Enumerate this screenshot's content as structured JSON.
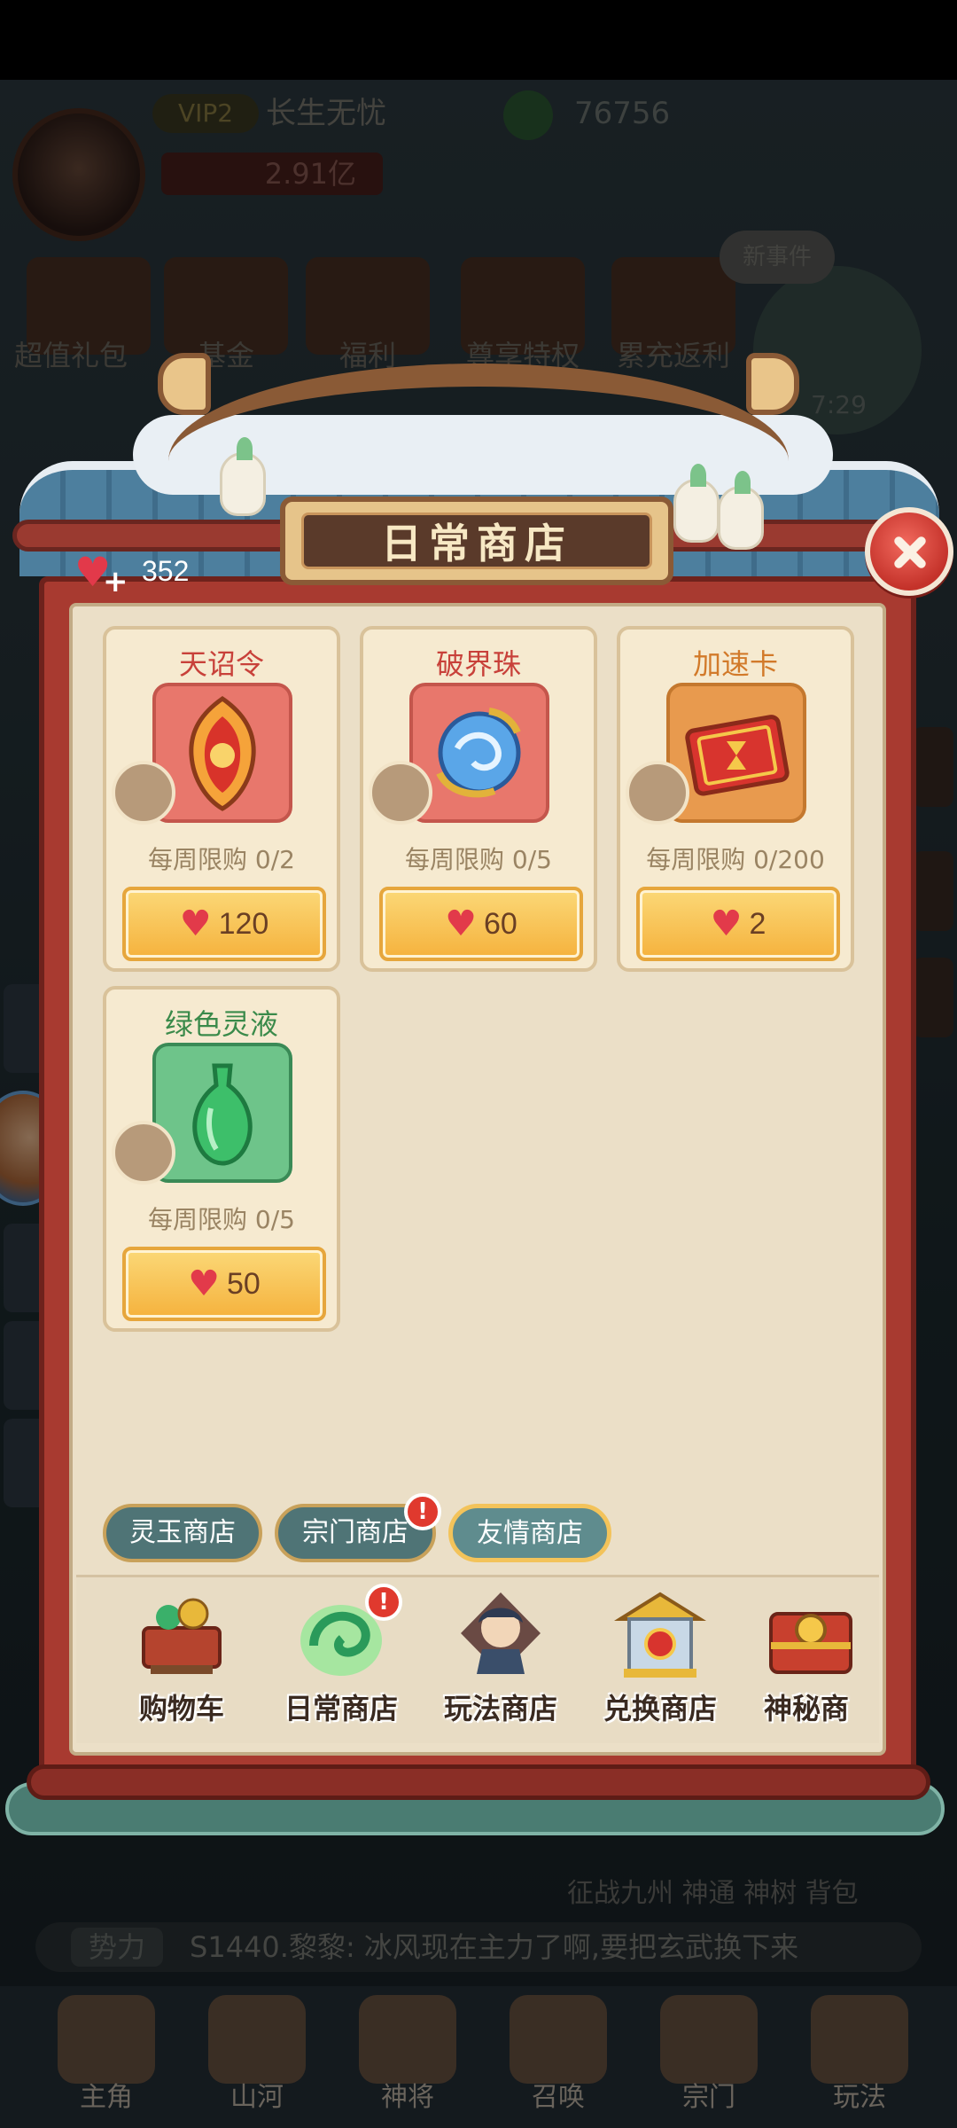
{
  "background": {
    "vip": "VIP2",
    "player_name": "长生无忧",
    "jade_amount": "76756",
    "power": "2.91亿",
    "top_icons": [
      "超值礼包",
      "基金",
      "福利",
      "尊享特权",
      "累充返利"
    ],
    "new_event": "新事件",
    "event_timer": "7:29",
    "bottom_icons": "征战九州   神通   神树   背包",
    "chat_tag": "势力",
    "chat_message": "S1440.黎黎:  冰风现在主力了啊,要把玄武换下来",
    "nav": [
      "主角",
      "山河",
      "神将",
      "召唤",
      "宗门",
      "玩法"
    ]
  },
  "modal": {
    "title": "日常商店",
    "currency_amount": "352",
    "items": [
      {
        "name": "天诏令",
        "limit": "每周限购 0/2",
        "price": "120",
        "name_color": "#c8413a",
        "icon": "scroll-token-icon"
      },
      {
        "name": "破界珠",
        "limit": "每周限购 0/5",
        "price": "60",
        "name_color": "#c8413a",
        "icon": "blue-orb-icon"
      },
      {
        "name": "加速卡",
        "limit": "每周限购 0/200",
        "price": "2",
        "name_color": "#d27a2a",
        "icon": "speed-card-icon"
      },
      {
        "name": "绿色灵液",
        "limit": "每周限购 0/5",
        "price": "50",
        "name_color": "#3a8a4a",
        "icon": "green-vase-icon"
      }
    ],
    "sub_tabs": [
      {
        "label": "灵玉商店",
        "badge": ""
      },
      {
        "label": "宗门商店",
        "badge": "!"
      },
      {
        "label": "友情商店",
        "badge": ""
      }
    ],
    "shop_tabs": [
      {
        "label": "购物车",
        "badge": ""
      },
      {
        "label": "日常商店",
        "badge": "!"
      },
      {
        "label": "玩法商店",
        "badge": ""
      },
      {
        "label": "兑换商店",
        "badge": ""
      },
      {
        "label": "神秘商",
        "badge": ""
      }
    ]
  },
  "colors": {
    "frame_red": "#a83a30",
    "panel_bg": "#ebdfc7",
    "buy_button": "#f5b23d",
    "heart": "#e23a4a",
    "tab_teal": "#4f7476"
  }
}
